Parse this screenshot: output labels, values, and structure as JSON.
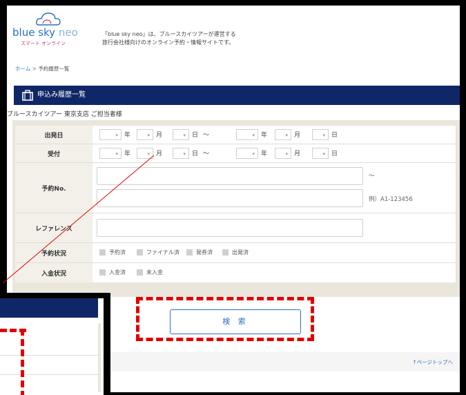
{
  "header": {
    "logo_brand": "blue sky",
    "logo_neo": "neo",
    "logo_sub": "スマート オンライン",
    "tagline_line1": "「blue sky neo」は、ブルースカイツアーが運営する",
    "tagline_line2": "旅行会社様向けのオンライン予約・情報サイトです。"
  },
  "breadcrumb": {
    "home": "ホーム",
    "separator": ">",
    "current": "予約履歴一覧"
  },
  "title": "申込み履歴一覧",
  "agency": "ブルースカイツアー 東京支店 ご担当者様",
  "form": {
    "departure_label": "出発日",
    "reception_label": "受付",
    "units": {
      "year": "年",
      "month": "月",
      "day": "日",
      "range": "～"
    },
    "reservation_no_label": "予約No.",
    "reservation_no_hint": "例）A1-123456",
    "reservation_range": "～",
    "reference_label": "レファレンス",
    "status_label": "予約状況",
    "status_options": [
      "予約済",
      "ファイナル済",
      "発券済",
      "出発済"
    ],
    "payment_label": "入金状況",
    "payment_options": [
      "入金済",
      "未入金"
    ]
  },
  "search_label": "検 索",
  "footer": {
    "pagetop": "↑ページトップへ"
  },
  "colors": {
    "brand_blue": "#2b6fc4",
    "navy": "#0f2766",
    "highlight_red": "#e00000"
  }
}
